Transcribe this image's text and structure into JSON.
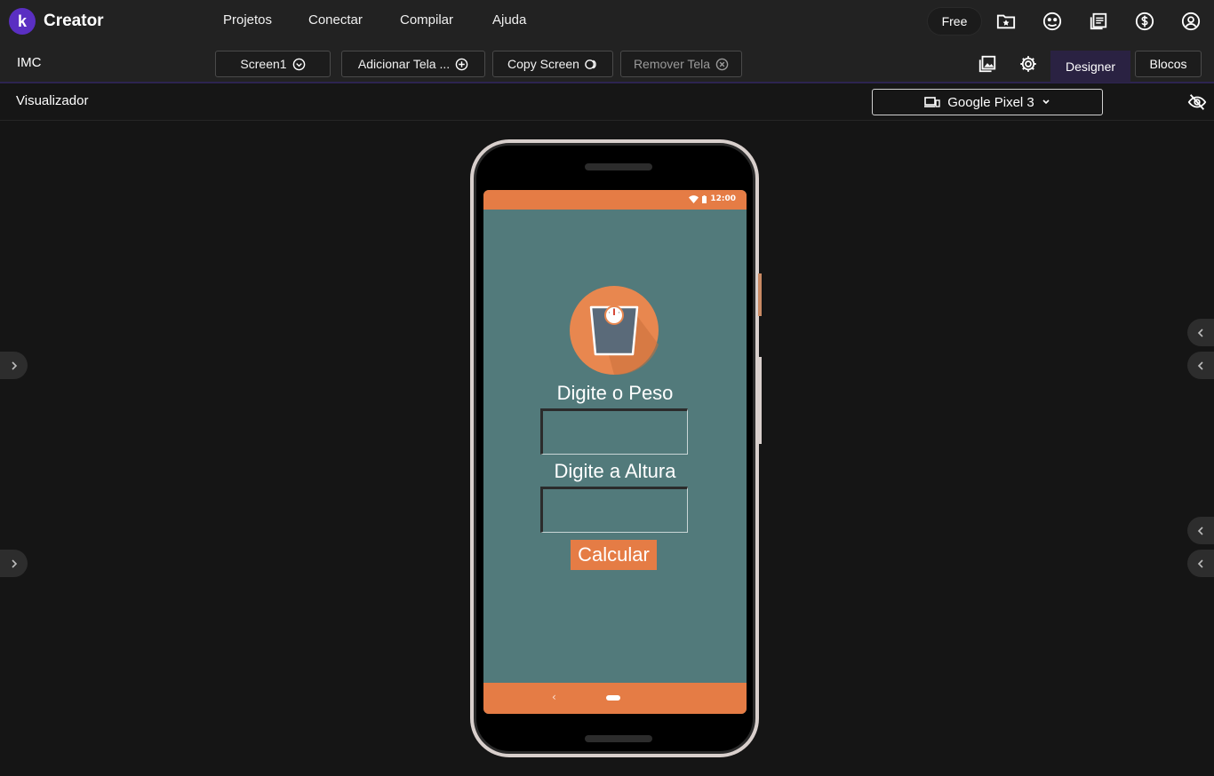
{
  "app": {
    "name": "Creator",
    "logo_letter": "k",
    "brand_color": "#5a2fc2"
  },
  "menu": [
    "Projetos",
    "Conectar",
    "Compilar",
    "Ajuda"
  ],
  "plan": "Free",
  "toolbar": {
    "project_name": "IMC",
    "screen_select": "Screen1",
    "add_screen": "Adicionar Tela ...",
    "copy_screen": "Copy Screen",
    "remove_screen": "Remover Tela",
    "designer": "Designer",
    "blocks": "Blocos"
  },
  "viewer": {
    "title": "Visualizador",
    "device": "Google Pixel 3"
  },
  "phone_app": {
    "status_time": "12:00",
    "weight_label": "Digite o Peso",
    "weight_value": "",
    "height_label": "Digite a Altura",
    "height_value": "",
    "calculate_button": "Calcular",
    "colors": {
      "background": "#527a7b",
      "accent": "#e57c45"
    }
  }
}
